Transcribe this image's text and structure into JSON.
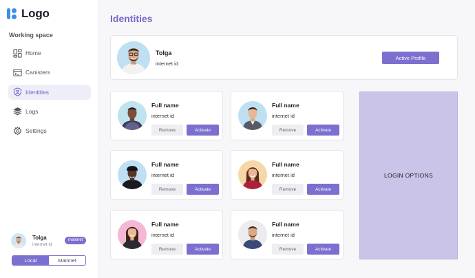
{
  "sidebar": {
    "logo_text": "Logo",
    "section_label": "Working space",
    "items": [
      {
        "label": "Home",
        "icon": "home-grid-icon",
        "active": false
      },
      {
        "label": "Canisters",
        "icon": "canister-window-icon",
        "active": false
      },
      {
        "label": "Identities",
        "icon": "shield-user-icon",
        "active": true
      },
      {
        "label": "Logs",
        "icon": "layers-icon",
        "active": false
      },
      {
        "label": "Settings",
        "icon": "gear-icon",
        "active": false
      }
    ],
    "profile": {
      "name": "Tolga",
      "id": "internet id",
      "badge": "mainnet"
    },
    "network": {
      "local": "Local",
      "mainnet": "Mainnet",
      "selected": "Local"
    }
  },
  "main": {
    "title": "Identities",
    "active_profile": {
      "name": "Tolga",
      "id": "internet id",
      "button": "Active Profile"
    },
    "identities": [
      {
        "name": "Full name",
        "id": "internet id",
        "remove": "Remove",
        "activate": "Activate",
        "bg": "#bfe3ef"
      },
      {
        "name": "Full name",
        "id": "internet id",
        "remove": "Remove",
        "activate": "Activate",
        "bg": "#bfe0f3"
      },
      {
        "name": "Full name",
        "id": "internet id",
        "remove": "Remove",
        "activate": "Activate",
        "bg": "#bfe0f3"
      },
      {
        "name": "Full name",
        "id": "internet id",
        "remove": "Remove",
        "activate": "Activate",
        "bg": "#f6d8a8"
      },
      {
        "name": "Full name",
        "id": "internet id",
        "remove": "Remove",
        "activate": "Activate",
        "bg": "#f4b8d6"
      },
      {
        "name": "Full name",
        "id": "internet id",
        "remove": "Remove",
        "activate": "Activate",
        "bg": "#ececef"
      }
    ],
    "login_options": "LOGIN OPTIONS"
  },
  "colors": {
    "accent": "#7b6fd0",
    "title": "#7469c7",
    "panel": "#c9c4e8",
    "logo": "#3b8fe8"
  }
}
